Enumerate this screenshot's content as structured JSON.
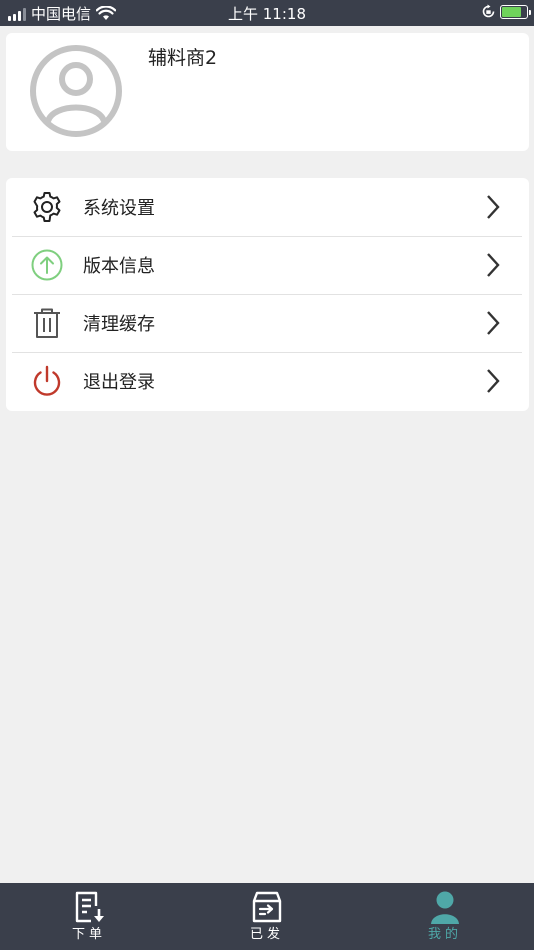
{
  "status_bar": {
    "carrier": "中国电信",
    "time": "上午 11:18"
  },
  "profile": {
    "name": "辅料商2",
    "avatar_icon": "user-avatar-icon"
  },
  "menu": {
    "items": [
      {
        "label": "系统设置",
        "icon": "gear-icon",
        "color": "#222222"
      },
      {
        "label": "版本信息",
        "icon": "arrow-up-circle-icon",
        "color": "#7fcf7f"
      },
      {
        "label": "清理缓存",
        "icon": "trash-icon",
        "color": "#555555"
      },
      {
        "label": "退出登录",
        "icon": "power-icon",
        "color": "#c0392b"
      }
    ]
  },
  "tab_bar": {
    "tabs": [
      {
        "label": "下单",
        "icon": "order-down-icon",
        "active": false
      },
      {
        "label": "已发",
        "icon": "sent-box-icon",
        "active": false
      },
      {
        "label": "我的",
        "icon": "person-icon",
        "active": true
      }
    ],
    "active_color": "#4fa8a8"
  }
}
